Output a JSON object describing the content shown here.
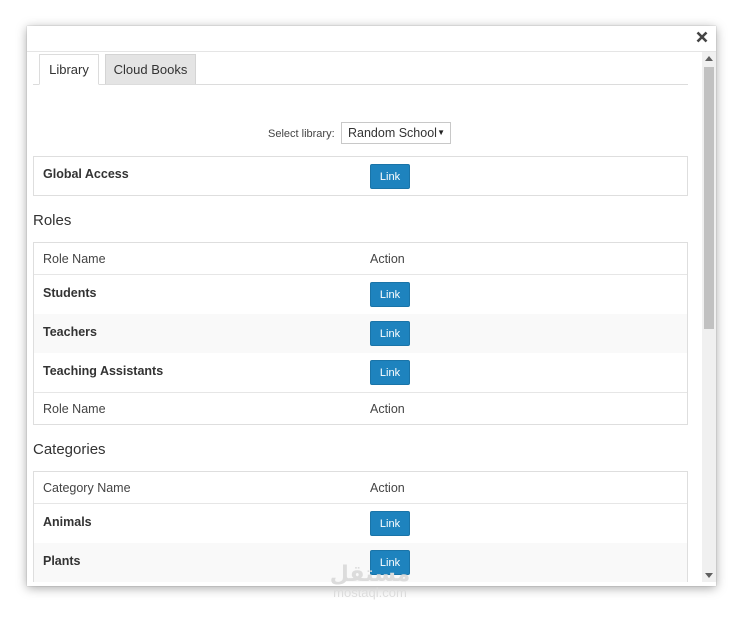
{
  "tabs": [
    {
      "label": "Library",
      "active": true
    },
    {
      "label": "Cloud Books",
      "active": false
    }
  ],
  "library_select": {
    "label": "Select library:",
    "value": "Random School"
  },
  "global_access": {
    "label": "Global Access",
    "button": "Link"
  },
  "roles": {
    "title": "Roles",
    "header": {
      "name": "Role Name",
      "action": "Action"
    },
    "rows": [
      {
        "name": "Students",
        "button": "Link"
      },
      {
        "name": "Teachers",
        "button": "Link"
      },
      {
        "name": "Teaching Assistants",
        "button": "Link"
      }
    ],
    "footer": {
      "name": "Role Name",
      "action": "Action"
    }
  },
  "categories": {
    "title": "Categories",
    "header": {
      "name": "Category Name",
      "action": "Action"
    },
    "rows": [
      {
        "name": "Animals",
        "button": "Link"
      },
      {
        "name": "Plants",
        "button": "Link"
      }
    ]
  },
  "watermark": {
    "arabic": "مستقل",
    "url": "mostaql.com"
  },
  "colors": {
    "link_button": "#1e83be",
    "tab_inactive": "#e4e4e4",
    "border": "#dedede"
  },
  "icons": {
    "close": "close-icon",
    "select_arrow": "caret-down-icon",
    "scroll_up": "triangle-up-icon",
    "scroll_down": "triangle-down-icon"
  }
}
